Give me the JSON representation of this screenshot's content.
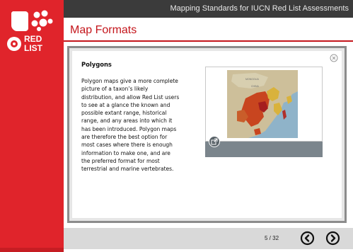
{
  "brand": {
    "logo_text_line1": "RED",
    "logo_text_line2": "LIST",
    "accent_color": "#e0242b"
  },
  "topbar": {
    "course_title": "Mapping Standards for IUCN Red List Assessments"
  },
  "header": {
    "page_title": "Map Formats"
  },
  "panel": {
    "close_icon": "close-circle-icon",
    "heading": "Polygons",
    "body": "Polygon maps give a more complete picture of a taxon’s likely distribution, and allow Red List users to see at a glance the known and possible extant range, historical range, and any areas into which it has been introduced. Polygon maps are therefore the best option for most cases where there is enough information to make one, and are the preferred format for most terrestrial and marine vertebrates.",
    "media": {
      "image": "range-map-east-asia",
      "map_label_1": "MONGOLIA",
      "map_label_2": "CHINA",
      "expand_icon": "expand-icon"
    }
  },
  "footer": {
    "page_counter": "5 / 32",
    "prev_icon": "chevron-left-circle-icon",
    "next_icon": "chevron-right-circle-icon"
  }
}
